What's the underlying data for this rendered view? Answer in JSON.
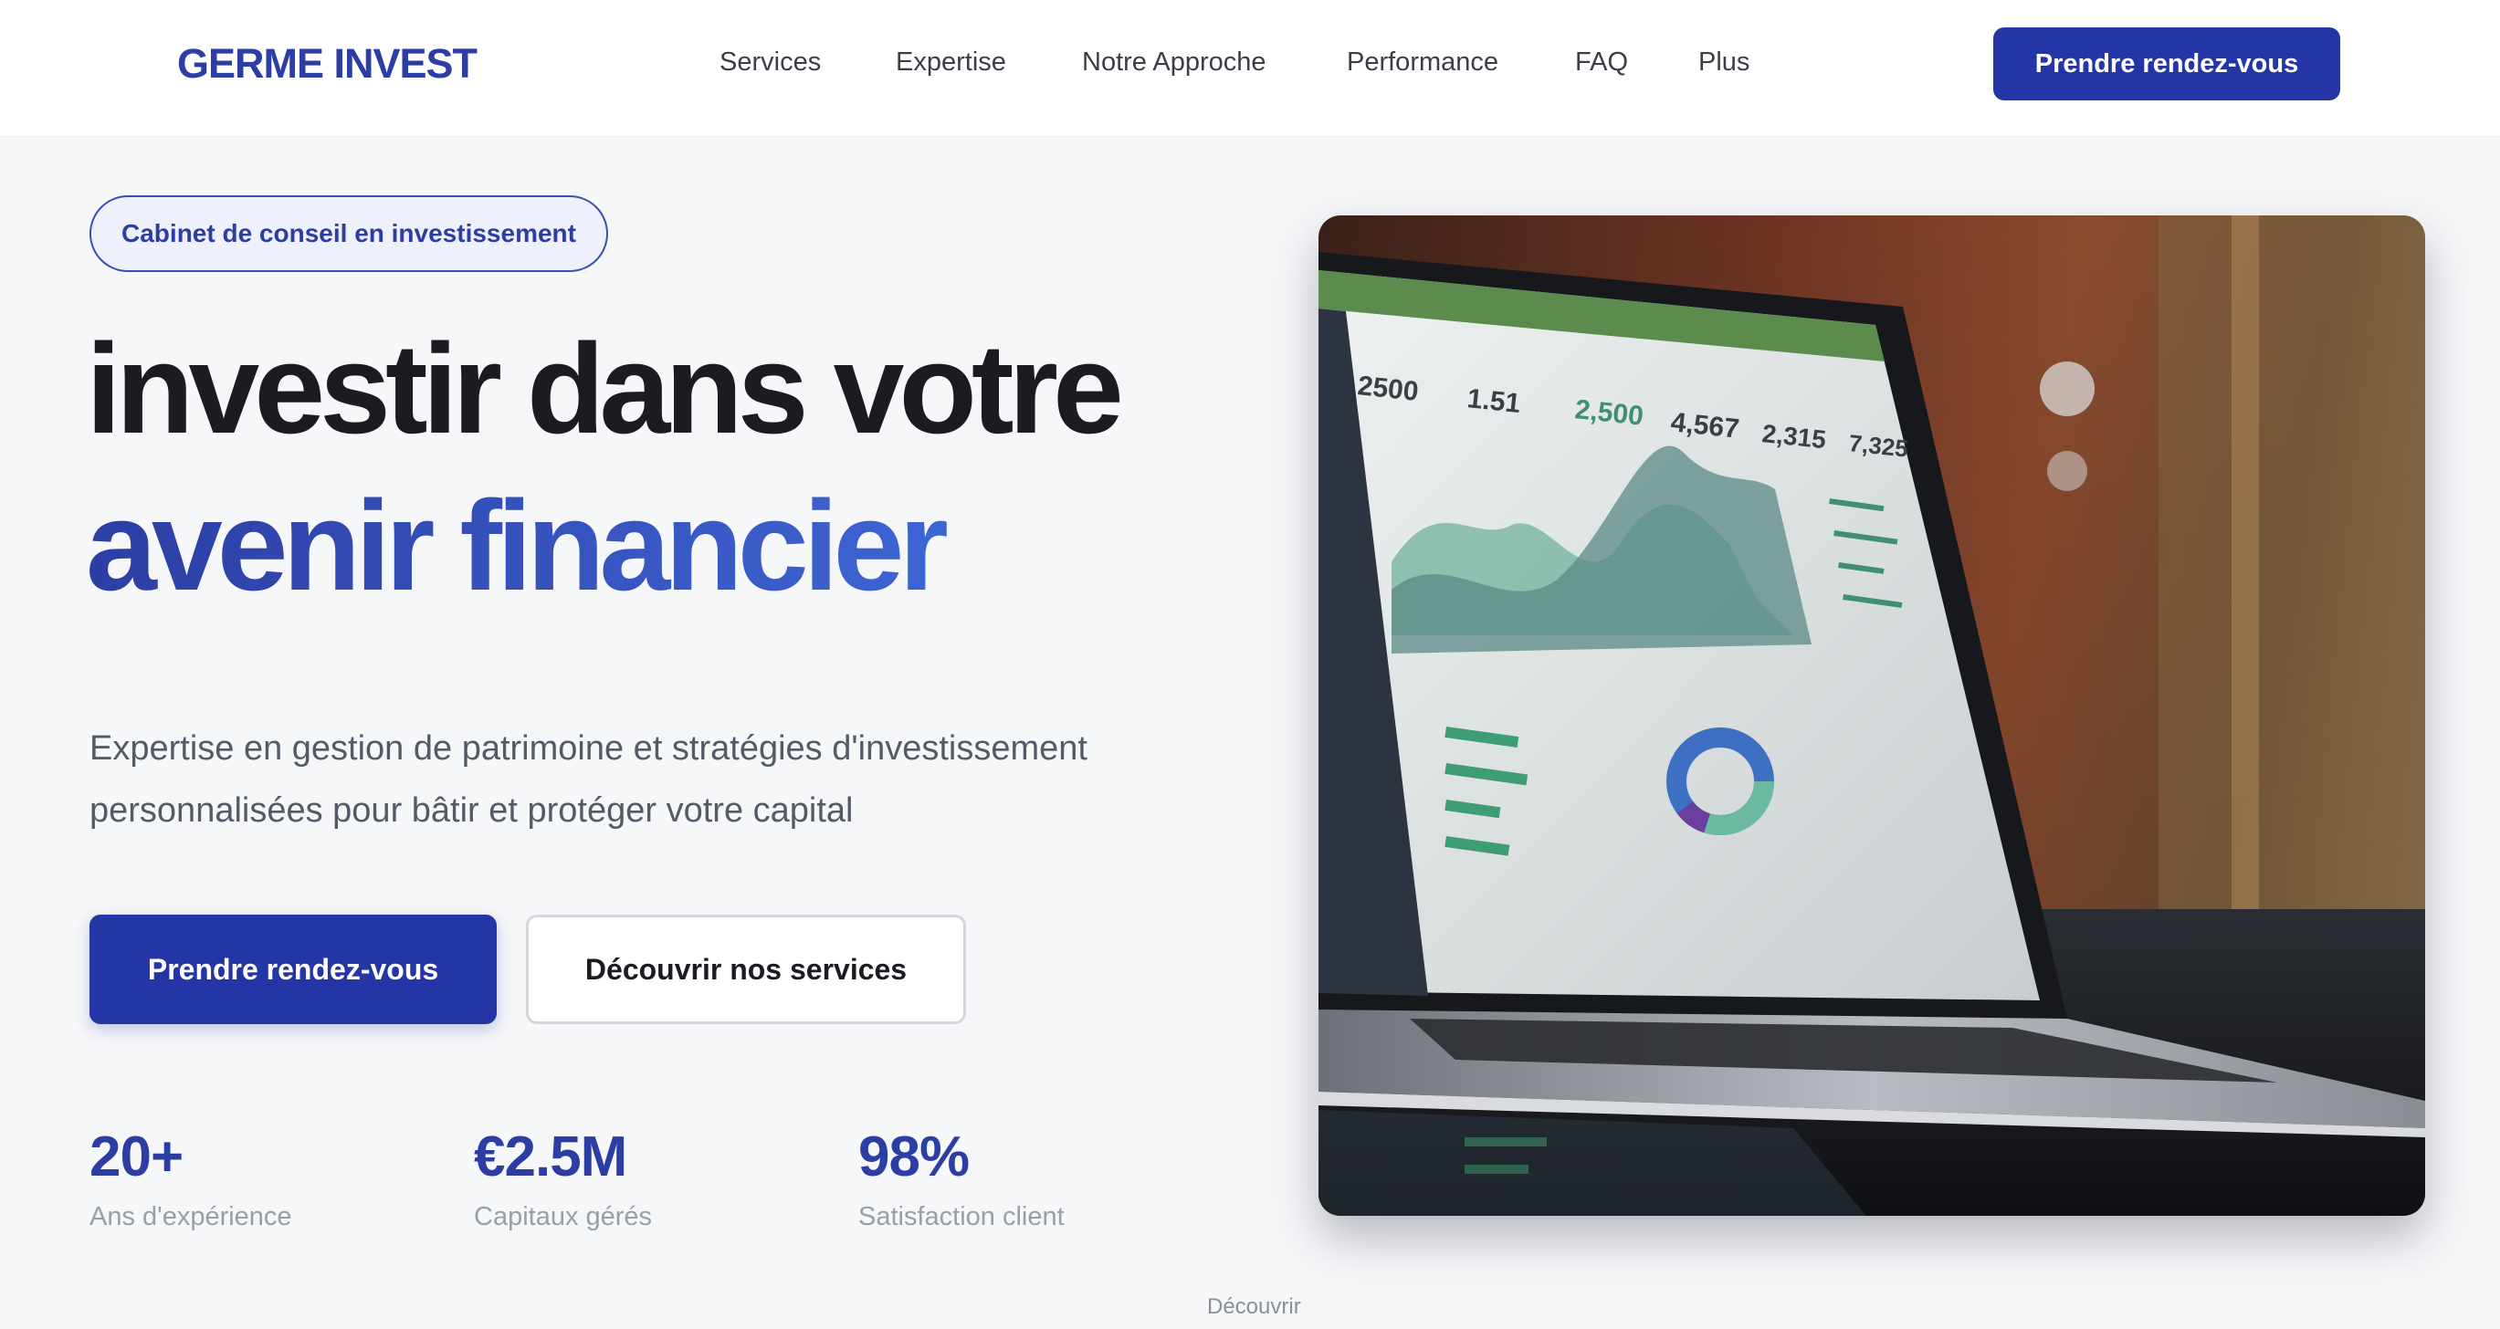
{
  "brand": {
    "name": "GERME INVEST"
  },
  "nav": {
    "items": [
      {
        "label": "Services"
      },
      {
        "label": "Expertise"
      },
      {
        "label": "Notre Approche"
      },
      {
        "label": "Performance"
      },
      {
        "label": "FAQ"
      },
      {
        "label": "Plus"
      }
    ],
    "cta_label": "Prendre rendez-vous"
  },
  "hero": {
    "badge": "Cabinet de conseil en investissement",
    "headline_line1": "investir dans votre",
    "headline_line2": "avenir financier",
    "subtitle_line1": "Expertise en gestion de patrimoine et stratégies d'investissement",
    "subtitle_line2": "personnalisées pour bâtir et protéger votre capital",
    "primary_button": "Prendre rendez-vous",
    "secondary_button": "Découvrir nos services",
    "image_alt_icon": "laptop-analytics-dashboard-photo"
  },
  "stats": [
    {
      "value": "20+",
      "label": "Ans d'expérience"
    },
    {
      "value": "€2.5M",
      "label": "Capitaux gérés"
    },
    {
      "value": "98%",
      "label": "Satisfaction client"
    }
  ],
  "scroll_hint": "Découvrir",
  "colors": {
    "brand": "#2c3ea3",
    "primary_button": "#2436a6",
    "gradient_end": "#4573e6",
    "page_background": "#f6f7f9"
  },
  "dashboard_screen": {
    "kpis": [
      "2500",
      "1.51",
      "2,500",
      "4,567",
      "2,315",
      "7,325"
    ]
  }
}
